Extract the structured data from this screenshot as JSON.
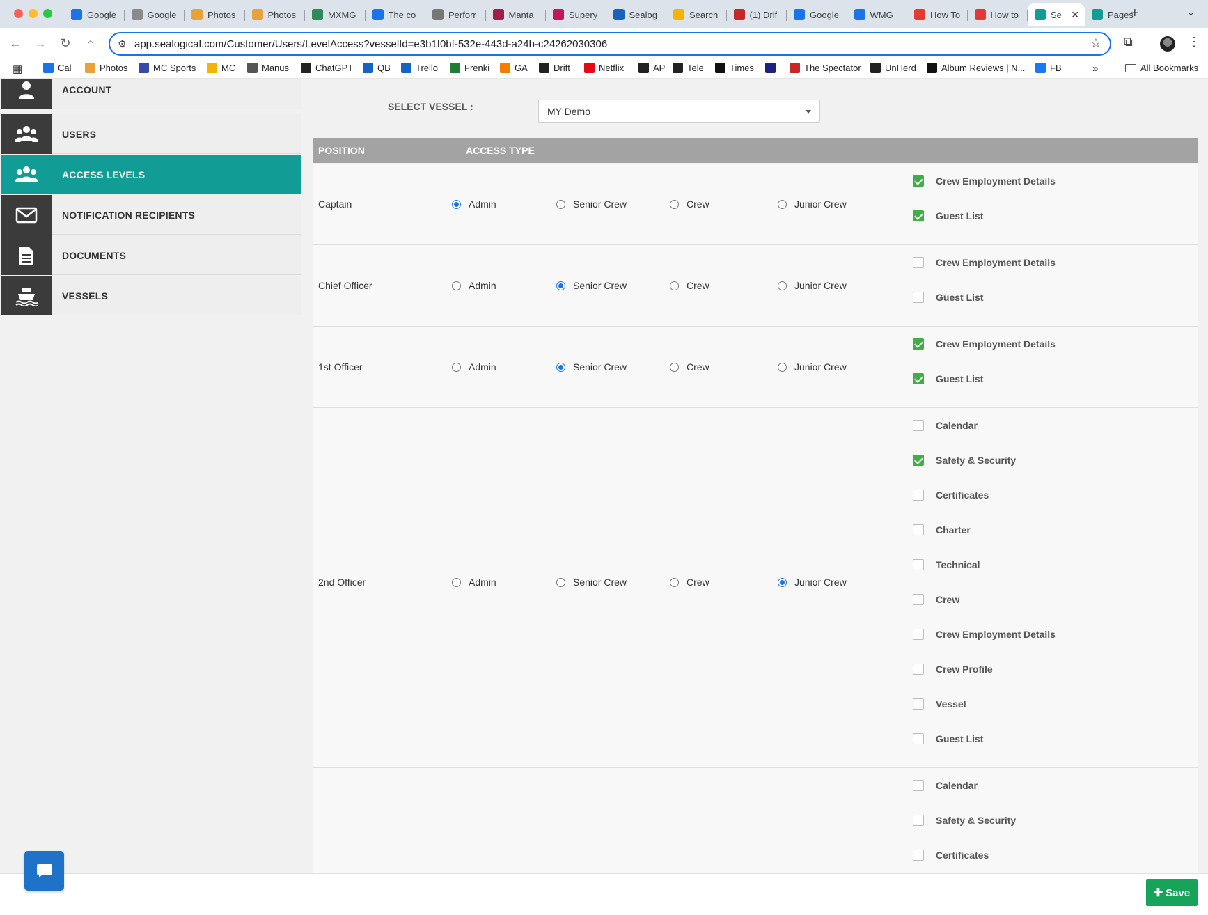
{
  "browser": {
    "tabs": [
      {
        "label": "Google",
        "color": "#1a73e8"
      },
      {
        "label": "Google",
        "color": "#8a8a8a"
      },
      {
        "label": "Photos",
        "color": "#e8a23b"
      },
      {
        "label": "Photos",
        "color": "#e8a23b"
      },
      {
        "label": "MXMG",
        "color": "#2e8b57"
      },
      {
        "label": "The co",
        "color": "#1a73e8"
      },
      {
        "label": "Perforr",
        "color": "#777777"
      },
      {
        "label": "Manta",
        "color": "#a31d4a"
      },
      {
        "label": "Supery",
        "color": "#c2185b"
      },
      {
        "label": "Sealog",
        "color": "#1565c0"
      },
      {
        "label": "Search",
        "color": "#f4b400"
      },
      {
        "label": "(1) Drif",
        "color": "#c62828"
      },
      {
        "label": "Google",
        "color": "#1a73e8"
      },
      {
        "label": "WMG",
        "color": "#1a73e8"
      },
      {
        "label": "How To",
        "color": "#e53935"
      },
      {
        "label": "How to",
        "color": "#e53935"
      },
      {
        "label": "Se",
        "color": "#119c95",
        "active": true
      },
      {
        "label": "Pages",
        "color": "#119c95"
      }
    ],
    "url": "app.sealogical.com/Customer/Users/LevelAccess?vesselId=e3b1f0bf-532e-443d-a24b-c24262030306",
    "bookmarks": [
      {
        "label": "Cal",
        "color": "#1a73e8"
      },
      {
        "label": "Photos",
        "color": "#e8a23b"
      },
      {
        "label": "MC Sports",
        "color": "#3949ab"
      },
      {
        "label": "MC",
        "color": "#f4b400"
      },
      {
        "label": "Manus",
        "color": "#555555"
      },
      {
        "label": "ChatGPT",
        "color": "#222222"
      },
      {
        "label": "QB",
        "color": "#1565c0"
      },
      {
        "label": "Trello",
        "color": "#1565c0"
      },
      {
        "label": "Frenki",
        "color": "#1e7e34"
      },
      {
        "label": "GA",
        "color": "#f57c00"
      },
      {
        "label": "Drift",
        "color": "#222222"
      },
      {
        "label": "Netflix",
        "color": "#e50914"
      },
      {
        "label": "AP",
        "color": "#222222"
      },
      {
        "label": "Tele",
        "color": "#222222"
      },
      {
        "label": "Times",
        "color": "#111111"
      },
      {
        "label": "",
        "color": "#1a237e"
      },
      {
        "label": "The Spectator",
        "color": "#c62828"
      },
      {
        "label": "UnHerd",
        "color": "#222222"
      },
      {
        "label": "Album Reviews | N...",
        "color": "#111111"
      },
      {
        "label": "FB",
        "color": "#1877f2"
      }
    ],
    "all_bookmarks": "All Bookmarks",
    "overflow": "»"
  },
  "sidebar": {
    "items": [
      {
        "label": "ACCOUNT",
        "icon": "user-icon"
      },
      {
        "label": "USERS",
        "icon": "users-icon"
      },
      {
        "label": "ACCESS LEVELS",
        "icon": "users-icon",
        "active": true
      },
      {
        "label": "NOTIFICATION RECIPIENTS",
        "icon": "envelope-icon"
      },
      {
        "label": "DOCUMENTS",
        "icon": "document-icon"
      },
      {
        "label": "VESSELS",
        "icon": "ship-icon"
      }
    ]
  },
  "vessel": {
    "label": "SELECT VESSEL :",
    "selected": "MY Demo"
  },
  "table": {
    "headers": {
      "position": "POSITION",
      "access_type": "ACCESS TYPE"
    },
    "access_options": [
      "Admin",
      "Senior Crew",
      "Crew",
      "Junior Crew"
    ],
    "rows": [
      {
        "position": "Captain",
        "access": "Admin",
        "permissions": [
          {
            "label": "Crew Employment Details",
            "checked": true
          },
          {
            "label": "Guest List",
            "checked": true
          }
        ]
      },
      {
        "position": "Chief Officer",
        "access": "Senior Crew",
        "permissions": [
          {
            "label": "Crew Employment Details",
            "checked": false
          },
          {
            "label": "Guest List",
            "checked": false
          }
        ]
      },
      {
        "position": "1st Officer",
        "access": "Senior Crew",
        "permissions": [
          {
            "label": "Crew Employment Details",
            "checked": true
          },
          {
            "label": "Guest List",
            "checked": true
          }
        ]
      },
      {
        "position": "2nd Officer",
        "access": "Junior Crew",
        "permissions": [
          {
            "label": "Calendar",
            "checked": false
          },
          {
            "label": "Safety & Security",
            "checked": true
          },
          {
            "label": "Certificates",
            "checked": false
          },
          {
            "label": "Charter",
            "checked": false
          },
          {
            "label": "Technical",
            "checked": false
          },
          {
            "label": "Crew",
            "checked": false
          },
          {
            "label": "Crew Employment Details",
            "checked": false
          },
          {
            "label": "Crew Profile",
            "checked": false
          },
          {
            "label": "Vessel",
            "checked": false
          },
          {
            "label": "Guest List",
            "checked": false
          }
        ]
      },
      {
        "position": "",
        "access": "",
        "permissions": [
          {
            "label": "Calendar",
            "checked": false
          },
          {
            "label": "Safety & Security",
            "checked": false
          },
          {
            "label": "Certificates",
            "checked": false
          }
        ]
      }
    ]
  },
  "footer": {
    "save_label": "Save",
    "chat_icon": "chat-icon"
  },
  "colors": {
    "accent": "#119c95",
    "save": "#17a35a",
    "checkbox_on": "#3fae49",
    "chat": "#1e73c8"
  }
}
